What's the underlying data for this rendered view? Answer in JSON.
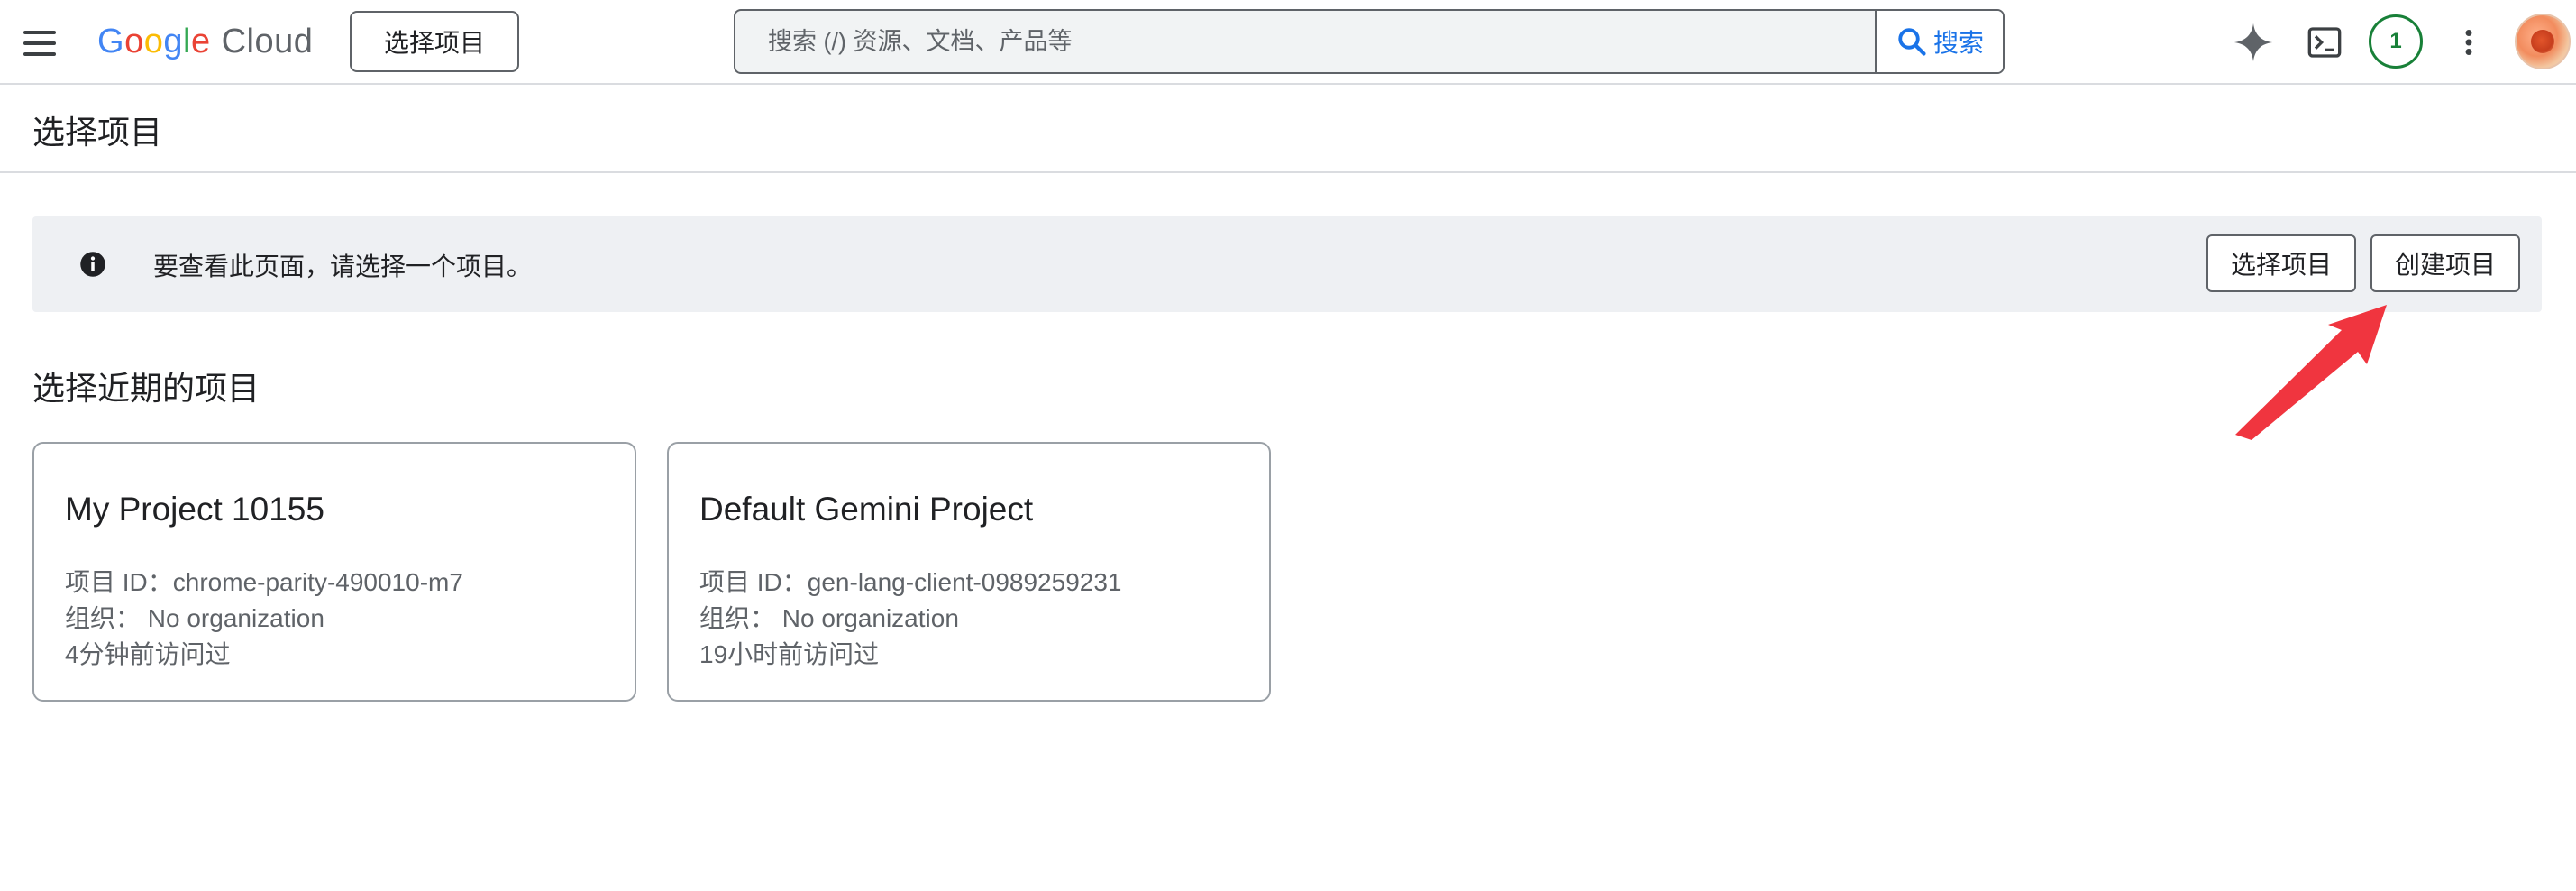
{
  "header": {
    "logo": {
      "google": "Google",
      "cloud": "Cloud"
    },
    "project_picker_label": "选择项目",
    "search": {
      "placeholder": "搜索 (/) 资源、文档、产品等",
      "button_label": "搜索"
    },
    "notification_count": "1",
    "icons": [
      "menu-icon",
      "gemini-spark-icon",
      "terminal-icon",
      "more-vert-icon",
      "search-icon",
      "avatar"
    ]
  },
  "page": {
    "title": "选择项目"
  },
  "banner": {
    "message": "要查看此页面，请选择一个项目。",
    "select_label": "选择项目",
    "create_label": "创建项目",
    "icon": "info-icon"
  },
  "recent": {
    "heading": "选择近期的项目",
    "projects": [
      {
        "name": "My Project 10155",
        "id_line": "项目 ID：chrome-parity-490010-m7",
        "org_line": "组织：  No organization",
        "accessed": "4分钟前访问过"
      },
      {
        "name": "Default Gemini Project",
        "id_line": "项目 ID：gen-lang-client-0989259231",
        "org_line": "组织：  No organization",
        "accessed": "19小时前访问过"
      }
    ]
  },
  "colors": {
    "brand_blue": "#4285F4",
    "brand_red": "#EA4335",
    "brand_yellow": "#FBBC05",
    "brand_green": "#34A853",
    "link_blue": "#1a73e8",
    "counter_green": "#188038",
    "banner_bg": "#eef0f3",
    "annotation_arrow": "#f0353f"
  }
}
